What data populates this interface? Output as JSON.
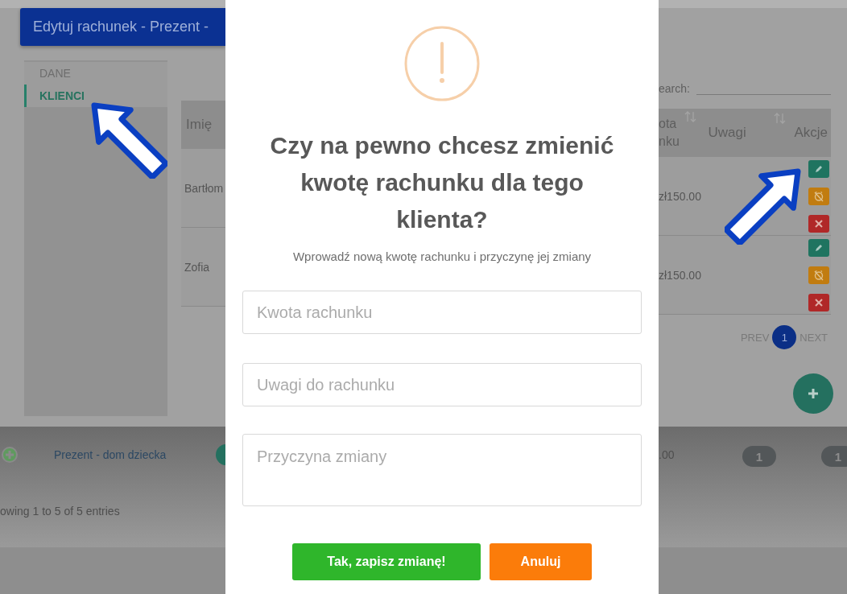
{
  "background_dialog": {
    "title": "Edytuj rachunek - Prezent -",
    "tabs": [
      {
        "label": "DANE",
        "selected": false
      },
      {
        "label": "KLIENCI",
        "selected": true
      }
    ],
    "search": {
      "label": "earch:"
    },
    "table": {
      "left_columns": [
        {
          "label": "Imię"
        }
      ],
      "right_columns": [
        {
          "lines": [
            "ota",
            "nku"
          ],
          "sortable": true
        },
        {
          "lines": [
            "Uwagi"
          ],
          "sortable": true
        },
        {
          "lines": [
            "Akcje"
          ],
          "sortable": false
        }
      ],
      "rows": [
        {
          "name": "Bartłom",
          "amount": "zł150.00",
          "actions": [
            {
              "kind": "edit"
            },
            {
              "kind": "cancel"
            },
            {
              "kind": "delete"
            }
          ]
        },
        {
          "name": "Zofia",
          "amount": "zł150.00",
          "actions": [
            {
              "kind": "edit"
            },
            {
              "kind": "cancel"
            },
            {
              "kind": "delete"
            }
          ]
        }
      ]
    },
    "pagination": {
      "prev": "PREV",
      "pages": [
        {
          "label": "1",
          "selected": true
        }
      ],
      "next": "NEXT"
    }
  },
  "outer_table": {
    "row": {
      "name": "Prezent - dom dziecka",
      "amount": ".00",
      "badges": [
        "1",
        "1"
      ]
    },
    "info": "owing 1 to 5 of 5 entries"
  },
  "modal": {
    "title": "Czy na pewno chcesz zmienić kwotę rachunku dla tego klienta?",
    "text": "Wprowadź nową kwotę rachunku i przyczynę jej zmiany",
    "fields": [
      {
        "kind": "input",
        "placeholder": "Kwota rachunku"
      },
      {
        "kind": "input",
        "placeholder": "Uwagi do rachunku"
      },
      {
        "kind": "textarea",
        "placeholder": "Przyczyna zmiany"
      }
    ],
    "buttons": [
      {
        "kind": "confirm",
        "label": "Tak, zapisz zmianę!"
      },
      {
        "kind": "cancel",
        "label": "Anuluj"
      }
    ]
  }
}
